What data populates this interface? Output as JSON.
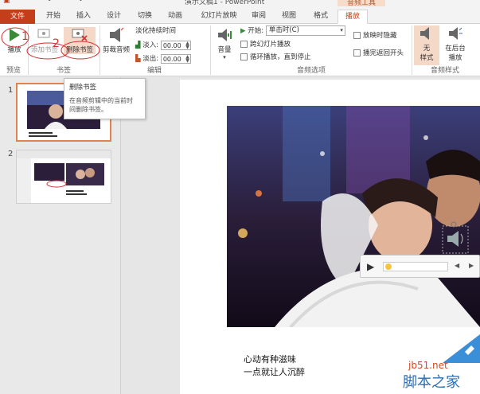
{
  "title_bar": {
    "doc_title": "演示文稿1 - PowerPoint",
    "context_group": "音频工具"
  },
  "tabs": [
    {
      "label": "文件"
    },
    {
      "label": "开始"
    },
    {
      "label": "插入"
    },
    {
      "label": "设计"
    },
    {
      "label": "切换"
    },
    {
      "label": "动画"
    },
    {
      "label": "幻灯片放映"
    },
    {
      "label": "审阅"
    },
    {
      "label": "视图"
    },
    {
      "label": "格式"
    },
    {
      "label": "播放"
    }
  ],
  "ribbon": {
    "preview": {
      "play_label": "播放",
      "group_label": "预览"
    },
    "bookmarks": {
      "add_label": "添加书签",
      "remove_label": "删除书签",
      "group_label": "书签"
    },
    "editing": {
      "trim_label": "剪裁音频",
      "fade_title": "淡化持续时间",
      "fade_in_label": "淡入:",
      "fade_in_value": "00.00",
      "fade_out_label": "淡出:",
      "fade_out_value": "00.00",
      "group_label": "编辑"
    },
    "audio_options": {
      "volume_label": "音量",
      "start_label": "开始:",
      "start_value": "单击时(C)",
      "play_across_label": "跨幻灯片播放",
      "loop_label": "循环播放，直到停止",
      "hide_label": "放映时隐藏",
      "rewind_label": "播完返回开头",
      "group_label": "音频选项"
    },
    "audio_styles": {
      "no_style_label_1": "无",
      "no_style_label_2": "样式",
      "bg_play_label_1": "在后台",
      "bg_play_label_2": "播放",
      "group_label": "音频样式"
    }
  },
  "tooltip": {
    "title": "删除书签",
    "desc_line1": "在音频剪辑中的当前时",
    "desc_line2": "间删除书签。"
  },
  "annotations": {
    "one": "1",
    "two": "2"
  },
  "thumbnails": [
    {
      "number": "1",
      "selected": true
    },
    {
      "number": "2",
      "selected": false
    }
  ],
  "slide": {
    "caption_line1": "心动有种滋味",
    "caption_line2": "一点就让人沉醉"
  },
  "watermark": {
    "url": "jb51.net",
    "name": "脚本之家"
  },
  "colors": {
    "accent": "#c43e1c",
    "annotation": "#d23030",
    "selected_thumb_border": "#e1834f"
  }
}
